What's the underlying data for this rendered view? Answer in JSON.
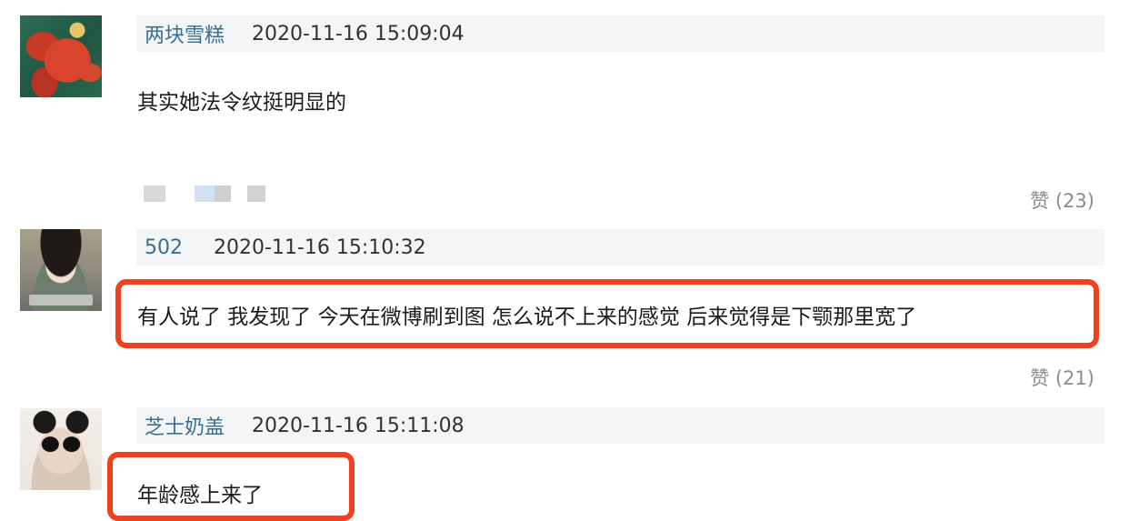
{
  "comments": [
    {
      "user": "两块雪糕",
      "time": "2020-11-16 15:09:04",
      "text": "其实她法令纹挺明显的",
      "likes": "赞 (23)"
    },
    {
      "user": "502",
      "time": "2020-11-16 15:10:32",
      "text": "有人说了 我发现了 今天在微博刷到图 怎么说不上来的感觉 后来觉得是下颚那里宽了",
      "likes": "赞 (21)"
    },
    {
      "user": "芝士奶盖",
      "time": "2020-11-16 15:11:08",
      "text": "年龄感上来了"
    }
  ],
  "colors": {
    "username": "#3a6f95",
    "highlight": "#f0401d",
    "meta_bar": "#f4f5f6",
    "like_text": "#8d8d8d"
  }
}
